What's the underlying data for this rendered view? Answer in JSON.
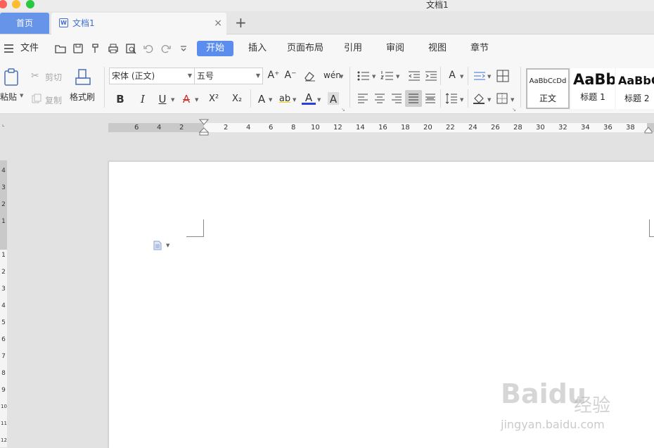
{
  "window": {
    "title": "文档1"
  },
  "tabs": {
    "home": "首页",
    "doc": "文档1",
    "add": "+",
    "close": "×"
  },
  "menu": {
    "file": "文件",
    "items": [
      "开始",
      "插入",
      "页面布局",
      "引用",
      "审阅",
      "视图",
      "章节"
    ]
  },
  "ribbon": {
    "paste": "粘贴",
    "cut": "剪切",
    "copy": "复制",
    "format_painter": "格式刷",
    "font_name": "宋体 (正文)",
    "font_size": "五号",
    "bold": "B",
    "italic": "I",
    "underline": "U",
    "strike": "A",
    "superscript": "X²",
    "subscript": "X₂",
    "grow": "A⁺",
    "shrink": "A⁻",
    "styles": [
      {
        "preview": "AaBbCcDd",
        "name": "正文"
      },
      {
        "preview": "AaBb",
        "name": "标题 1"
      },
      {
        "preview": "AaBbC",
        "name": "标题 2"
      }
    ]
  },
  "ruler": {
    "left_ticks": [
      "6",
      "4",
      "2",
      "2"
    ],
    "ticks": [
      "4",
      "6",
      "8",
      "10",
      "12",
      "14",
      "16",
      "18",
      "20",
      "22",
      "24",
      "26",
      "28",
      "30",
      "32",
      "34",
      "36",
      "38"
    ],
    "vertical": [
      "4",
      "3",
      "2",
      "1",
      "1",
      "2",
      "3",
      "4",
      "5",
      "6",
      "7",
      "8",
      "9",
      "10",
      "11",
      "12"
    ]
  },
  "watermark": {
    "logo": "Baidu",
    "cn": "经验",
    "url": "jingyan.baidu.com"
  },
  "colors": {
    "accent": "#5b8def",
    "home_tab": "#6694e8",
    "doc_tab_text": "#3e6fd6",
    "close": "#fe5f57",
    "minimize": "#febc2e",
    "zoom": "#28c840"
  }
}
